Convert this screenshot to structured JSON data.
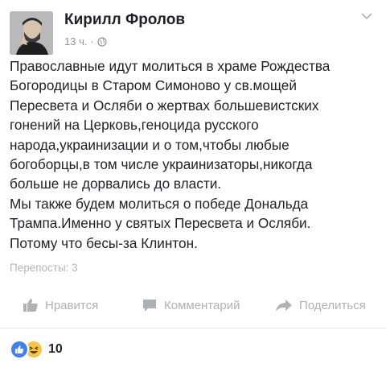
{
  "post": {
    "author": "Кирилл Фролов",
    "time": "13 ч.",
    "separator": "·",
    "text_lines": [
      "Православные идут молиться в храме Рождества",
      "Богородицы в Старом Симоново у св.мощей",
      "Пересвета и Осляби о жертвах большевистских",
      "гонений на Церковь,геноцида русского",
      "народа,украинизации и о том,чтобы любые",
      "богоборцы,в том числе украинизаторы,никогда",
      "больше не дорвались до власти.",
      "Мы также будем молиться о победе Дональда",
      "Трампа.Именно у святых Пересвета и Осляби.",
      "Потому что бесы-за Клинтон."
    ],
    "reposts": "Перепосты: 3"
  },
  "actions": {
    "like": "Нравится",
    "comment": "Комментарий",
    "share": "Поделиться"
  },
  "reactions": {
    "count": "10",
    "types": [
      "like-icon",
      "haha-icon"
    ]
  },
  "colors": {
    "text": "#1d2129",
    "muted": "#90949c",
    "action": "#aeb1b6",
    "like_blue": "#4080ff",
    "haha_yellow": "#f7c544"
  }
}
